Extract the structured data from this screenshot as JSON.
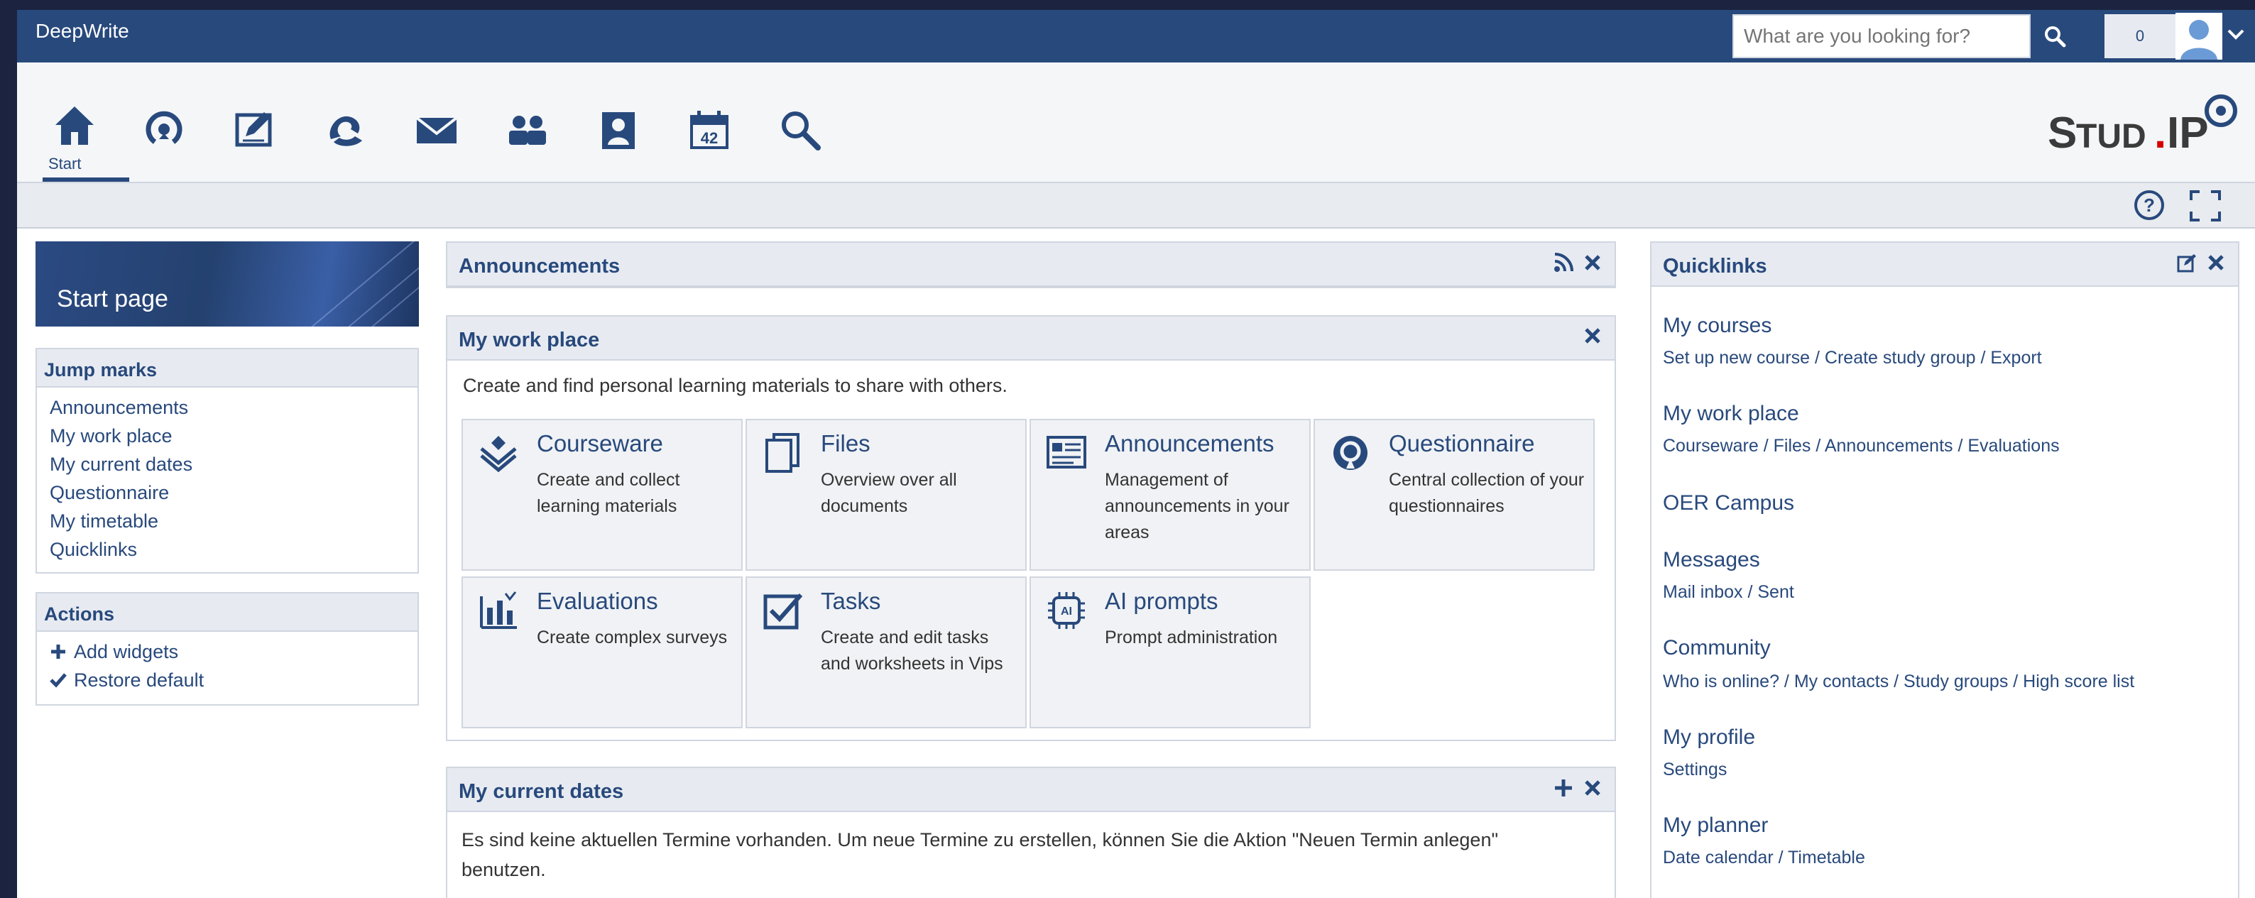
{
  "app": {
    "brand": "DeepWrite"
  },
  "search": {
    "placeholder": "What are you looking for?"
  },
  "header": {
    "notification_count": "0"
  },
  "nav": {
    "active_label": "Start"
  },
  "logo": {
    "text_main": "STUD",
    "text_dot": ".",
    "text_end": "IP"
  },
  "sidebar": {
    "title": "Start page",
    "jump_marks": {
      "title": "Jump marks",
      "items": [
        "Announcements",
        "My work place",
        "My current dates",
        "Questionnaire",
        "My timetable",
        "Quicklinks"
      ]
    },
    "actions": {
      "title": "Actions",
      "items": [
        "Add widgets",
        "Restore default"
      ]
    }
  },
  "widgets": {
    "announcements": {
      "title": "Announcements"
    },
    "workplace": {
      "title": "My work place",
      "intro": "Create and find personal learning materials to share with others.",
      "tiles": [
        {
          "title": "Courseware",
          "desc": "Create and collect learning materials"
        },
        {
          "title": "Files",
          "desc": "Overview over all documents"
        },
        {
          "title": "Announcements",
          "desc": "Management of announcements in your areas"
        },
        {
          "title": "Questionnaire",
          "desc": "Central collection of your questionnaires"
        },
        {
          "title": "Evaluations",
          "desc": "Create complex surveys"
        },
        {
          "title": "Tasks",
          "desc": "Create and edit tasks and worksheets in Vips"
        },
        {
          "title": "AI prompts",
          "desc": "Prompt administration"
        }
      ]
    },
    "dates": {
      "title": "My current dates",
      "text": "Es sind keine aktuellen Termine vorhanden. Um neue Termine zu erstellen, können Sie die Aktion \"Neuen Termin anlegen\" benutzen."
    },
    "quicklinks": {
      "title": "Quicklinks",
      "sections": [
        {
          "title": "My courses",
          "links": "Set up new course / Create study group / Export"
        },
        {
          "title": "My work place",
          "links": "Courseware / Files / Announcements / Evaluations"
        },
        {
          "title": "OER Campus",
          "links": ""
        },
        {
          "title": "Messages",
          "links": "Mail inbox / Sent"
        },
        {
          "title": "Community",
          "links": "Who is online? / My contacts / Study groups / High score list"
        },
        {
          "title": "My profile",
          "links": "Settings"
        },
        {
          "title": "My planner",
          "links": "Date calendar / Timetable"
        }
      ]
    }
  },
  "colors": {
    "primary": "#28497c",
    "accent_red": "#d60000",
    "panel": "#e7ebf1"
  },
  "icons": {
    "nav": [
      "home-icon",
      "activity-icon",
      "courses-icon",
      "community-icon",
      "mail-icon",
      "people-icon",
      "profile-icon",
      "calendar-icon",
      "search-icon"
    ]
  }
}
